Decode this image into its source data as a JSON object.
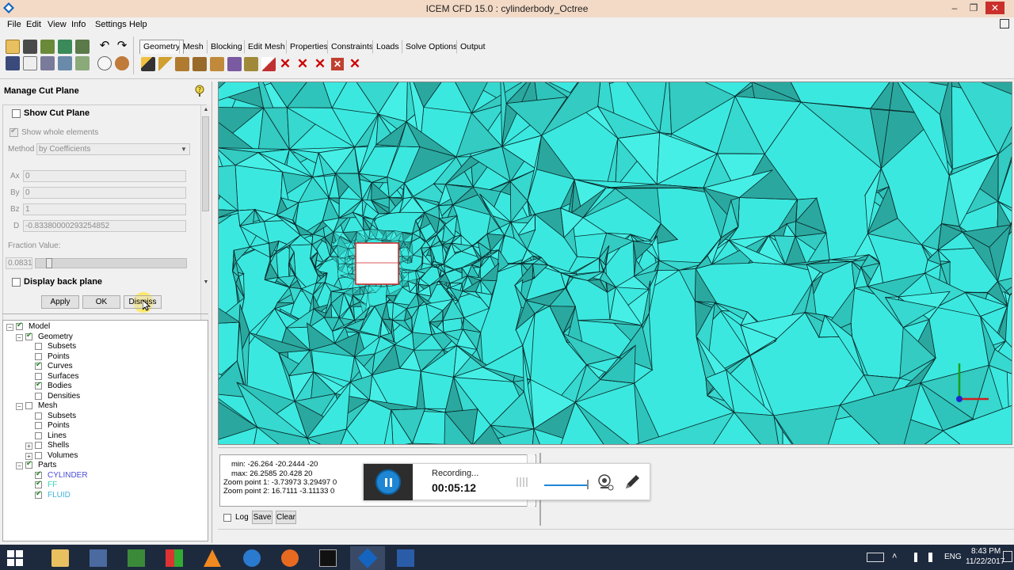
{
  "window": {
    "title": "ICEM CFD 15.0 : cylinderbody_Octree",
    "controls": {
      "minimize": "‒",
      "maximize": "❐",
      "close": "✕"
    }
  },
  "menu": [
    "File",
    "Edit",
    "View",
    "Info",
    "Settings",
    "Help"
  ],
  "tabs": [
    "Geometry",
    "Mesh",
    "Blocking",
    "Edit Mesh",
    "Properties",
    "Constraints",
    "Loads",
    "Solve Options",
    "Output"
  ],
  "active_tab": "Geometry",
  "panel": {
    "title": "Manage Cut Plane",
    "show_cut_plane": "Show Cut Plane",
    "show_whole_elements": "Show whole elements",
    "method_label": "Method",
    "method_value": "by Coefficients",
    "ax_label": "Ax",
    "ax_value": "0",
    "by_label": "By",
    "by_value": "0",
    "bz_label": "Bz",
    "bz_value": "1",
    "d_label": "D",
    "d_value": "-0.83380000293254852",
    "fraction_label": "Fraction Value:",
    "fraction_value": "0.0831",
    "display_back_plane": "Display back plane",
    "apply": "Apply",
    "ok": "OK",
    "dismiss": "Dismiss"
  },
  "tree": [
    {
      "label": "Model",
      "level": 0,
      "checked": true,
      "expander": "−"
    },
    {
      "label": "Geometry",
      "level": 1,
      "checked": true,
      "expander": "−"
    },
    {
      "label": "Subsets",
      "level": 2,
      "checked": false
    },
    {
      "label": "Points",
      "level": 2,
      "checked": false
    },
    {
      "label": "Curves",
      "level": 2,
      "checked": true
    },
    {
      "label": "Surfaces",
      "level": 2,
      "checked": false
    },
    {
      "label": "Bodies",
      "level": 2,
      "checked": true
    },
    {
      "label": "Densities",
      "level": 2,
      "checked": false
    },
    {
      "label": "Mesh",
      "level": 1,
      "checked": false,
      "expander": "−"
    },
    {
      "label": "Subsets",
      "level": 2,
      "checked": false
    },
    {
      "label": "Points",
      "level": 2,
      "checked": false
    },
    {
      "label": "Lines",
      "level": 2,
      "checked": false
    },
    {
      "label": "Shells",
      "level": 2,
      "checked": false,
      "expander": "+"
    },
    {
      "label": "Volumes",
      "level": 2,
      "checked": false,
      "expander": "+"
    },
    {
      "label": "Parts",
      "level": 1,
      "checked": true,
      "expander": "−"
    },
    {
      "label": "CYLINDER",
      "level": 2,
      "checked": true,
      "color": "#4a4ad8"
    },
    {
      "label": "FF",
      "level": 2,
      "checked": true,
      "color": "#3fd0b5"
    },
    {
      "label": "FLUID",
      "level": 2,
      "checked": true,
      "color": "#3fb2d8"
    }
  ],
  "messages": [
    "min: -26.264 -20.2444 -20",
    "max: 26.2585 20.428 20",
    "Zoom point 1: -3.73973 3.29497 0",
    "Zoom point 2: 16.7111 -3.11133 0"
  ],
  "msg_controls": {
    "log": "Log",
    "save": "Save",
    "clear": "Clear"
  },
  "recorder": {
    "status": "Recording...",
    "time": "00:05:12"
  },
  "taskbar": {
    "lang": "ENG",
    "time": "8:43 PM",
    "date": "11/22/2017"
  },
  "colors": {
    "mesh_fill": "#3be8df",
    "mesh_dark": "#2bb8ad",
    "mesh_line": "#0a2a2a",
    "accent": "#1f86d4"
  }
}
